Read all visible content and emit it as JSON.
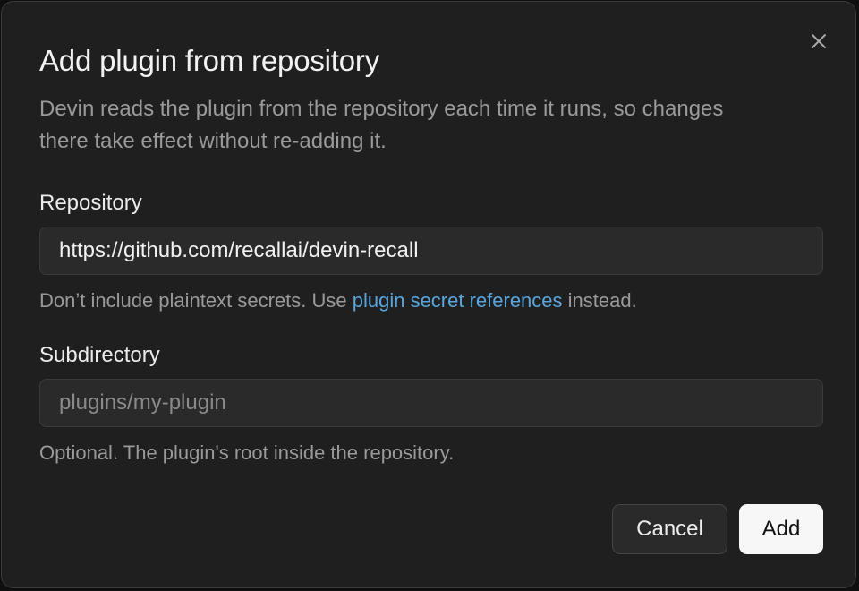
{
  "dialog": {
    "title": "Add plugin from repository",
    "description": "Devin reads the plugin from the repository each time it runs, so changes there take effect without re-adding it.",
    "close_icon": "close-icon"
  },
  "repository": {
    "label": "Repository",
    "value": "https://github.com/recallai/devin-recall",
    "hint_before": "Don’t include plaintext secrets. Use ",
    "hint_link": "plugin secret references",
    "hint_after": " instead."
  },
  "subdirectory": {
    "label": "Subdirectory",
    "value": "",
    "placeholder": "plugins/my-plugin",
    "hint": "Optional. The plugin's root inside the repository."
  },
  "actions": {
    "cancel_label": "Cancel",
    "add_label": "Add"
  },
  "colors": {
    "background": "#1f1f1f",
    "link": "#5aa6dc",
    "primary_button": "#f7f7f7"
  }
}
